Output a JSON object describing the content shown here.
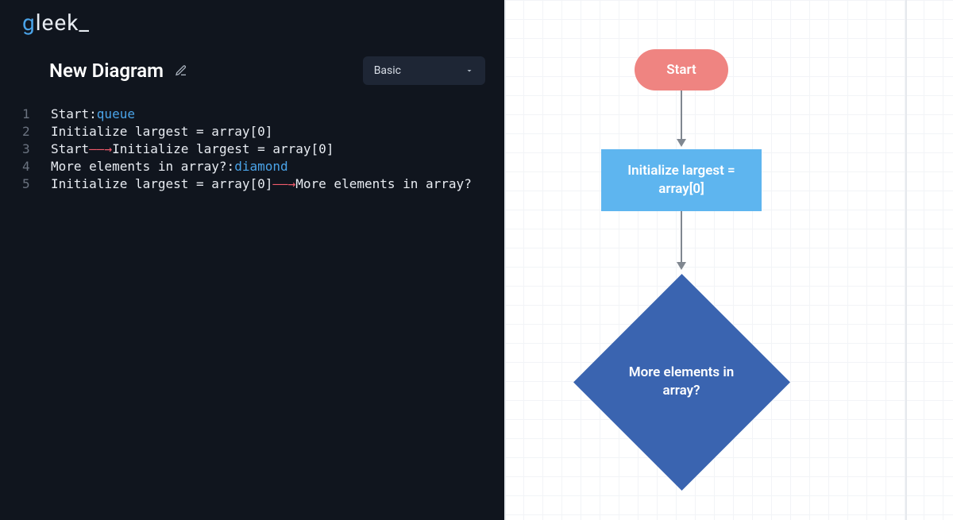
{
  "logo": {
    "prefix": "g",
    "rest": "leek_"
  },
  "header": {
    "title": "New Diagram",
    "dropdown_label": "Basic"
  },
  "code": {
    "lines": [
      {
        "n": "1",
        "pre": "Start:",
        "type": "queue",
        "post": ""
      },
      {
        "n": "2",
        "pre": "Initialize largest = array[0]",
        "type": "",
        "post": ""
      },
      {
        "n": "3",
        "pre": "Start",
        "arrow": "——→",
        "post": "Initialize largest = array[0]"
      },
      {
        "n": "4",
        "pre": "More elements in array?:",
        "type": "diamond",
        "post": ""
      },
      {
        "n": "5",
        "pre": "Initialize largest = array[0]",
        "arrow": "——→",
        "post": "More elements in array?"
      }
    ]
  },
  "flowchart": {
    "start_label": "Start",
    "process_label": "Initialize largest = array[0]",
    "diamond_label": "More elements in array?"
  },
  "colors": {
    "editor_bg": "#10151e",
    "accent_blue": "#4aa3e8",
    "node_start": "#ef8481",
    "node_process": "#5eb5ef",
    "node_diamond": "#3a64b0"
  }
}
